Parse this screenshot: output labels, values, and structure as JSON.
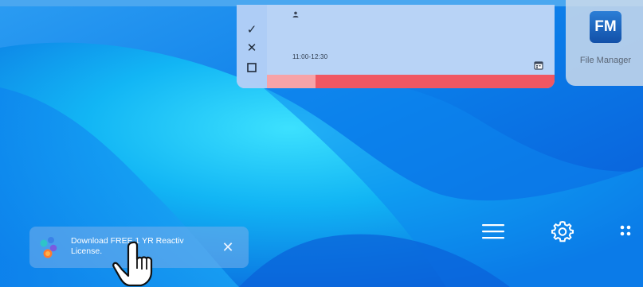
{
  "calendar_widget": {
    "actions": [
      {
        "icon": "check-icon",
        "glyph": "✓"
      },
      {
        "icon": "close-icon",
        "glyph": "✕"
      },
      {
        "icon": "square-icon",
        "glyph": "☐"
      }
    ],
    "time_range": "11:00-12:30",
    "progress_fraction": 0.17,
    "colors": {
      "progress": "#f05762",
      "progress_done": "#f6a3a8"
    }
  },
  "app_tile": {
    "icon_text": "FM",
    "label": "File Manager"
  },
  "notification": {
    "text_line1": "Download FREE 1 YR Reactiv",
    "text_line2": "License.",
    "close_glyph": "✕"
  },
  "dock": {
    "menu_icon": "hamburger-menu-icon",
    "settings_icon": "gear-icon",
    "apps_icon": "app-grid-icon"
  },
  "pointer": "hand-pointer-icon"
}
